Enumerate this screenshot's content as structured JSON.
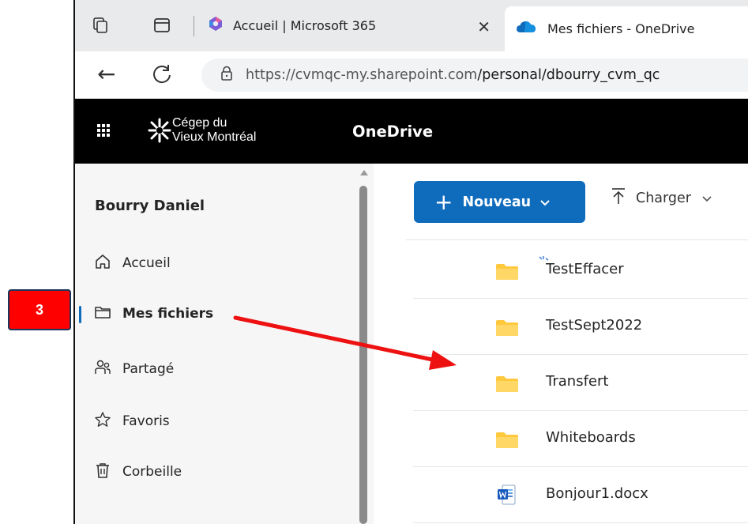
{
  "browser": {
    "tabs": [
      {
        "title": "Accueil | Microsoft 365",
        "close_glyph": "✕",
        "icon": "microsoft365-icon"
      },
      {
        "title": "Mes fichiers - OneDrive",
        "icon": "onedrive-cloud-icon"
      }
    ],
    "address_bar": {
      "url_host": "https://cvmqc-my.sharepoint.com",
      "url_path": "/personal/dbourry_cvm_qc",
      "back_glyph": "←"
    }
  },
  "app": {
    "org_logo_line1": "Cégep du",
    "org_logo_line2": "Vieux Montréal",
    "name": "OneDrive"
  },
  "nav": {
    "user": "Bourry Daniel",
    "items": [
      {
        "label": "Accueil",
        "icon": "home-icon"
      },
      {
        "label": "Mes fichiers",
        "icon": "folder-icon",
        "active": true
      },
      {
        "label": "Partagé",
        "icon": "people-icon"
      },
      {
        "label": "Favoris",
        "icon": "star-icon"
      },
      {
        "label": "Corbeille",
        "icon": "trash-icon"
      }
    ]
  },
  "toolbar": {
    "new_label": "Nouveau",
    "new_plus": "+",
    "upload_label": "Charger",
    "chevron_glyph": "⌄"
  },
  "files": [
    {
      "name": "TestEffacer",
      "type": "folder"
    },
    {
      "name": "TestSept2022",
      "type": "folder"
    },
    {
      "name": "Transfert",
      "type": "folder"
    },
    {
      "name": "Whiteboards",
      "type": "folder"
    },
    {
      "name": "Bonjour1.docx",
      "type": "word-document"
    }
  ],
  "annotation": {
    "step_number": "3",
    "badge_color": "#ff0000",
    "arrow_color": "#ee1111"
  },
  "colors": {
    "accent": "#0f6cbd",
    "folder": "#ffc83d"
  }
}
